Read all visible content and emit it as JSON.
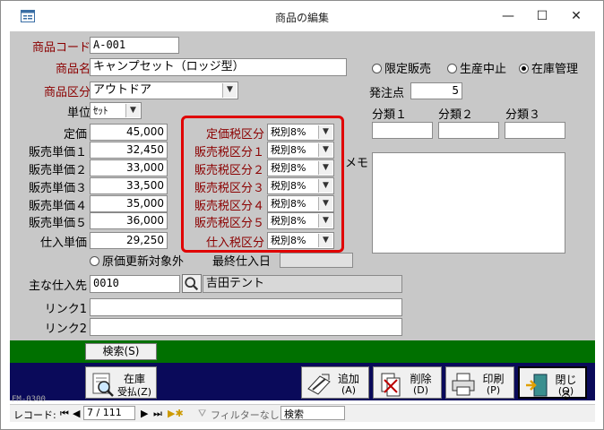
{
  "window": {
    "title": "商品の編集",
    "minimize": "—",
    "maximize": "☐",
    "close": "✕"
  },
  "product": {
    "code_label": "商品コード",
    "code": "A-001",
    "name_label": "商品名",
    "name": "キャンプセット（ロッジ型）",
    "category_label": "商品区分",
    "category": "アウトドア",
    "unit_label": "単位",
    "unit": "ｾｯﾄ"
  },
  "prices": [
    {
      "label": "定価",
      "value": "45,000"
    },
    {
      "label": "販売単価１",
      "value": "32,450"
    },
    {
      "label": "販売単価２",
      "value": "33,000"
    },
    {
      "label": "販売単価３",
      "value": "33,500"
    },
    {
      "label": "販売単価４",
      "value": "35,000"
    },
    {
      "label": "販売単価５",
      "value": "36,000"
    },
    {
      "label": "仕入単価",
      "value": "29,250"
    }
  ],
  "tax": [
    {
      "label": "定価税区分",
      "value": "税別8%"
    },
    {
      "label": "販売税区分１",
      "value": "税別8%"
    },
    {
      "label": "販売税区分２",
      "value": "税別8%"
    },
    {
      "label": "販売税区分３",
      "value": "税別8%"
    },
    {
      "label": "販売税区分４",
      "value": "税別8%"
    },
    {
      "label": "販売税区分５",
      "value": "税別8%"
    },
    {
      "label": "仕入税区分",
      "value": "税別8%"
    }
  ],
  "status_radios": {
    "limited": "限定販売",
    "discontinued": "生産中止",
    "inventory": "在庫管理",
    "selected": "inventory"
  },
  "order_point": {
    "label": "発注点",
    "value": "5"
  },
  "classes": {
    "c1": "分類１",
    "c2": "分類２",
    "c3": "分類３"
  },
  "memo_label": "メモ",
  "price_update": {
    "label": "原価更新対象外",
    "last_purchase_label": "最終仕入日"
  },
  "supplier": {
    "label": "主な仕入先",
    "code": "0010",
    "name": "吉田テント"
  },
  "links": {
    "link1": "リンク1",
    "link2": "リンク2"
  },
  "buttons": {
    "search": "検索(S)",
    "stock_t1": "在庫",
    "stock_t2": "受払(Z)",
    "add_t1": "追加",
    "add_t2": "(A)",
    "delete_t1": "削除",
    "delete_t2": "(D)",
    "print_t1": "印刷",
    "print_t2": "(P)",
    "close_t1": "閉じる",
    "close_t2": "(Q)"
  },
  "form_id": "FM-0300",
  "statusbar": {
    "record_label": "レコード:",
    "record": "7 / 111",
    "filter": "フィルターなし",
    "search": "検索"
  }
}
